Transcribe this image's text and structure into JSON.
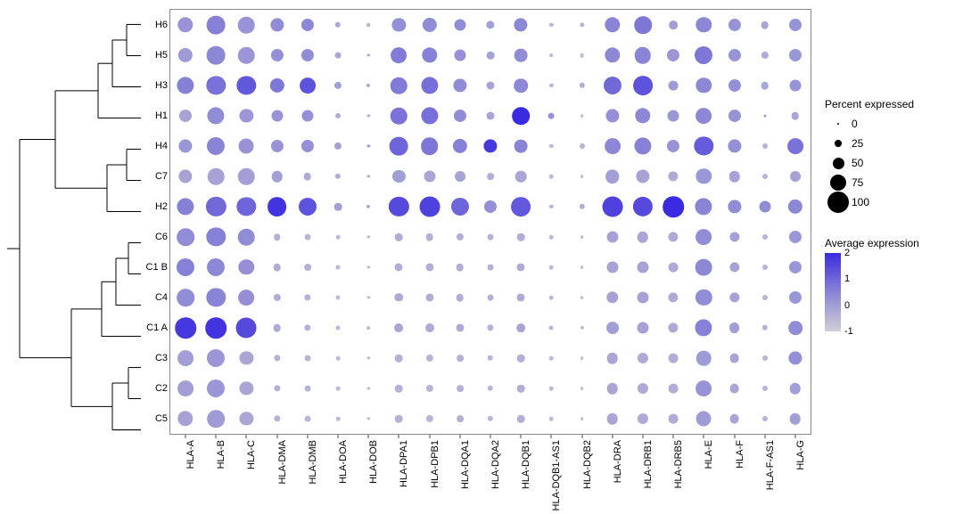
{
  "chart_data": {
    "type": "dotplot",
    "title": "",
    "xlabel": "",
    "ylabel": "",
    "size_legend_title": "Percent expressed",
    "color_legend_title": "Average expression",
    "size_legend_values": [
      0,
      25,
      50,
      75,
      100
    ],
    "color_legend_values": [
      2,
      1,
      0,
      -1
    ],
    "color_scale_domain": [
      -1.5,
      2.5
    ],
    "color_scale_colors": [
      "#cfcfd6",
      "#8a84d6",
      "#3a2be0"
    ],
    "columns": [
      "HLA-A",
      "HLA-B",
      "HLA-C",
      "HLA-DMA",
      "HLA-DMB",
      "HLA-DOA",
      "HLA-DOB",
      "HLA-DPA1",
      "HLA-DPB1",
      "HLA-DQA1",
      "HLA-DQA2",
      "HLA-DQB1",
      "HLA-DQB1-AS1",
      "HLA-DQB2",
      "HLA-DRA",
      "HLA-DRB1",
      "HLA-DRB5",
      "HLA-E",
      "HLA-F",
      "HLA-F-AS1",
      "HLA-G"
    ],
    "row_order": [
      "H6",
      "H5",
      "H3",
      "H1",
      "H4",
      "C7",
      "H2",
      "C6",
      "C1 B",
      "C4",
      "C1 A",
      "C3",
      "C2",
      "C5"
    ],
    "dendrogram_clusters": {
      "pair_h6_h5": [
        "H6",
        "H5"
      ],
      "pair_h3": [
        "pair_h6_h5",
        "H3"
      ],
      "pair_h1": [
        "pair_h3",
        "H1"
      ],
      "pair_h4_c7": [
        "H4",
        "C7"
      ],
      "pair_h2": [
        "pair_h4_c7",
        "H2"
      ],
      "top_a": [
        "pair_h1",
        "pair_h2"
      ],
      "pair_c6_c1b": [
        "C6",
        "C1 B"
      ],
      "pair_c4": [
        "pair_c6_c1b",
        "C4"
      ],
      "pair_c1a": [
        "pair_c4",
        "C1 A"
      ],
      "pair_c3_c2": [
        "C3",
        "C2"
      ],
      "pair_c5": [
        "pair_c3_c2",
        "C5"
      ],
      "bot_b": [
        "pair_c1a",
        "pair_c5"
      ],
      "root": [
        "top_a",
        "bot_b"
      ]
    },
    "series": [
      {
        "name": "H6",
        "percent": [
          70,
          85,
          75,
          60,
          55,
          20,
          8,
          60,
          65,
          50,
          33,
          60,
          10,
          15,
          70,
          80,
          35,
          70,
          55,
          30,
          55
        ],
        "expression": [
          0.1,
          0.6,
          0.1,
          0.3,
          0.4,
          -0.4,
          -0.6,
          0.2,
          0.3,
          0.3,
          -0.2,
          0.4,
          -0.8,
          -0.8,
          0.5,
          0.8,
          -0.2,
          0.4,
          0.1,
          -0.4,
          0.1
        ]
      },
      {
        "name": "H5",
        "percent": [
          65,
          85,
          75,
          55,
          55,
          22,
          6,
          72,
          70,
          50,
          30,
          58,
          8,
          12,
          70,
          75,
          55,
          82,
          55,
          28,
          55
        ],
        "expression": [
          -0.1,
          0.4,
          0.0,
          0.2,
          0.3,
          -0.4,
          -0.7,
          0.7,
          0.6,
          0.2,
          -0.3,
          0.3,
          -0.9,
          -0.9,
          0.4,
          0.5,
          0.0,
          0.8,
          0.1,
          -0.5,
          0.0
        ]
      },
      {
        "name": "H3",
        "percent": [
          78,
          88,
          88,
          65,
          72,
          28,
          10,
          75,
          78,
          60,
          32,
          62,
          10,
          20,
          82,
          90,
          40,
          70,
          55,
          30,
          50
        ],
        "expression": [
          0.6,
          0.9,
          1.5,
          0.8,
          1.6,
          -0.2,
          -0.5,
          0.7,
          1.0,
          0.3,
          -0.3,
          0.4,
          -0.8,
          -0.6,
          1.1,
          1.6,
          -0.1,
          0.4,
          0.2,
          -0.4,
          0.1
        ]
      },
      {
        "name": "H1",
        "percent": [
          55,
          78,
          60,
          50,
          50,
          18,
          6,
          75,
          78,
          55,
          32,
          80,
          22,
          8,
          60,
          70,
          50,
          72,
          55,
          4,
          30
        ],
        "expression": [
          -0.3,
          0.3,
          0.0,
          0.1,
          0.2,
          -0.6,
          -0.8,
          0.9,
          1.0,
          0.3,
          -0.4,
          2.5,
          0.2,
          -1.0,
          0.2,
          0.4,
          0.0,
          0.4,
          0.1,
          -0.1,
          -0.4
        ]
      },
      {
        "name": "H4",
        "percent": [
          60,
          82,
          68,
          55,
          55,
          28,
          6,
          85,
          80,
          65,
          60,
          58,
          10,
          18,
          72,
          78,
          55,
          88,
          60,
          18,
          72
        ],
        "expression": [
          0.0,
          0.5,
          0.1,
          0.1,
          0.2,
          -0.3,
          -0.1,
          1.2,
          0.8,
          0.6,
          2.2,
          0.5,
          -0.9,
          -0.7,
          0.4,
          0.6,
          0.1,
          1.4,
          0.2,
          -0.7,
          0.9
        ]
      },
      {
        "name": "C7",
        "percent": [
          60,
          75,
          75,
          48,
          30,
          20,
          6,
          55,
          50,
          45,
          26,
          48,
          12,
          8,
          62,
          60,
          42,
          70,
          48,
          18,
          45
        ],
        "expression": [
          -0.3,
          -0.3,
          -0.2,
          -0.2,
          -0.5,
          -0.6,
          -0.8,
          -0.2,
          -0.4,
          -0.3,
          -0.6,
          -0.4,
          -0.9,
          -1.0,
          -0.2,
          -0.3,
          -0.5,
          0.0,
          -0.3,
          -0.8,
          -0.3
        ]
      },
      {
        "name": "H2",
        "percent": [
          78,
          92,
          88,
          90,
          82,
          30,
          10,
          92,
          95,
          82,
          55,
          90,
          10,
          20,
          95,
          92,
          98,
          78,
          60,
          50,
          65
        ],
        "expression": [
          0.6,
          1.1,
          1.2,
          2.3,
          1.6,
          -0.2,
          -0.5,
          1.8,
          2.0,
          1.2,
          0.2,
          1.5,
          -0.8,
          -0.6,
          2.0,
          1.8,
          2.5,
          0.5,
          0.3,
          0.3,
          0.4
        ]
      },
      {
        "name": "C6",
        "percent": [
          80,
          88,
          75,
          25,
          22,
          12,
          6,
          30,
          30,
          28,
          22,
          30,
          12,
          8,
          50,
          48,
          42,
          72,
          42,
          18,
          55
        ],
        "expression": [
          0.3,
          0.6,
          0.3,
          -0.7,
          -0.8,
          -0.9,
          -1.0,
          -0.6,
          -0.7,
          -0.6,
          -0.7,
          -0.6,
          -0.9,
          -1.0,
          -0.3,
          -0.4,
          -0.5,
          0.3,
          -0.3,
          -0.8,
          0.0
        ]
      },
      {
        "name": "C1 B",
        "percent": [
          82,
          82,
          70,
          30,
          26,
          14,
          6,
          32,
          32,
          30,
          22,
          32,
          12,
          8,
          50,
          50,
          40,
          76,
          42,
          18,
          55
        ],
        "expression": [
          0.6,
          0.4,
          0.2,
          -0.6,
          -0.7,
          -0.9,
          -1.0,
          -0.6,
          -0.6,
          -0.6,
          -0.7,
          -0.5,
          -0.9,
          -1.0,
          -0.3,
          -0.3,
          -0.5,
          0.4,
          -0.3,
          -0.8,
          0.0
        ]
      },
      {
        "name": "C4",
        "percent": [
          80,
          88,
          72,
          28,
          24,
          14,
          6,
          34,
          32,
          30,
          22,
          32,
          12,
          8,
          52,
          50,
          42,
          74,
          42,
          18,
          55
        ],
        "expression": [
          0.3,
          0.5,
          0.2,
          -0.6,
          -0.7,
          -0.9,
          -1.0,
          -0.5,
          -0.6,
          -0.6,
          -0.7,
          -0.5,
          -0.9,
          -1.0,
          -0.3,
          -0.3,
          -0.5,
          0.3,
          -0.3,
          -0.8,
          0.0
        ]
      },
      {
        "name": "C1 A",
        "percent": [
          98,
          98,
          95,
          30,
          24,
          14,
          8,
          36,
          36,
          32,
          24,
          35,
          14,
          10,
          54,
          50,
          42,
          78,
          45,
          20,
          62
        ],
        "expression": [
          2.2,
          2.3,
          1.8,
          -0.5,
          -0.7,
          -0.9,
          -0.9,
          -0.4,
          -0.5,
          -0.5,
          -0.7,
          -0.4,
          -0.8,
          -0.9,
          -0.2,
          -0.3,
          -0.5,
          0.6,
          -0.2,
          -0.7,
          0.3
        ]
      },
      {
        "name": "C3",
        "percent": [
          72,
          82,
          60,
          24,
          22,
          12,
          6,
          30,
          28,
          26,
          20,
          30,
          12,
          8,
          48,
          46,
          40,
          66,
          40,
          18,
          60
        ],
        "expression": [
          -0.2,
          0.0,
          -0.4,
          -0.7,
          -0.8,
          -0.9,
          -1.0,
          -0.7,
          -0.8,
          -0.7,
          -0.8,
          -0.6,
          -0.9,
          -1.0,
          -0.4,
          -0.5,
          -0.6,
          -0.1,
          -0.4,
          -0.8,
          0.2
        ]
      },
      {
        "name": "C2",
        "percent": [
          72,
          82,
          60,
          24,
          22,
          12,
          6,
          30,
          28,
          26,
          20,
          30,
          12,
          8,
          48,
          46,
          40,
          72,
          40,
          18,
          48
        ],
        "expression": [
          -0.2,
          0.0,
          -0.4,
          -0.7,
          -0.8,
          -0.9,
          -1.0,
          -0.7,
          -0.8,
          -0.7,
          -0.8,
          -0.6,
          -0.9,
          -1.0,
          -0.4,
          -0.5,
          -0.6,
          0.1,
          -0.4,
          -0.8,
          -0.2
        ]
      },
      {
        "name": "C5",
        "percent": [
          70,
          80,
          60,
          24,
          22,
          12,
          6,
          30,
          28,
          26,
          20,
          30,
          12,
          8,
          48,
          46,
          40,
          68,
          40,
          18,
          48
        ],
        "expression": [
          -0.3,
          -0.1,
          -0.4,
          -0.7,
          -0.8,
          -0.9,
          -1.0,
          -0.7,
          -0.8,
          -0.7,
          -0.8,
          -0.6,
          -0.9,
          -1.0,
          -0.4,
          -0.5,
          -0.6,
          -0.1,
          -0.4,
          -0.8,
          -0.2
        ]
      }
    ]
  }
}
